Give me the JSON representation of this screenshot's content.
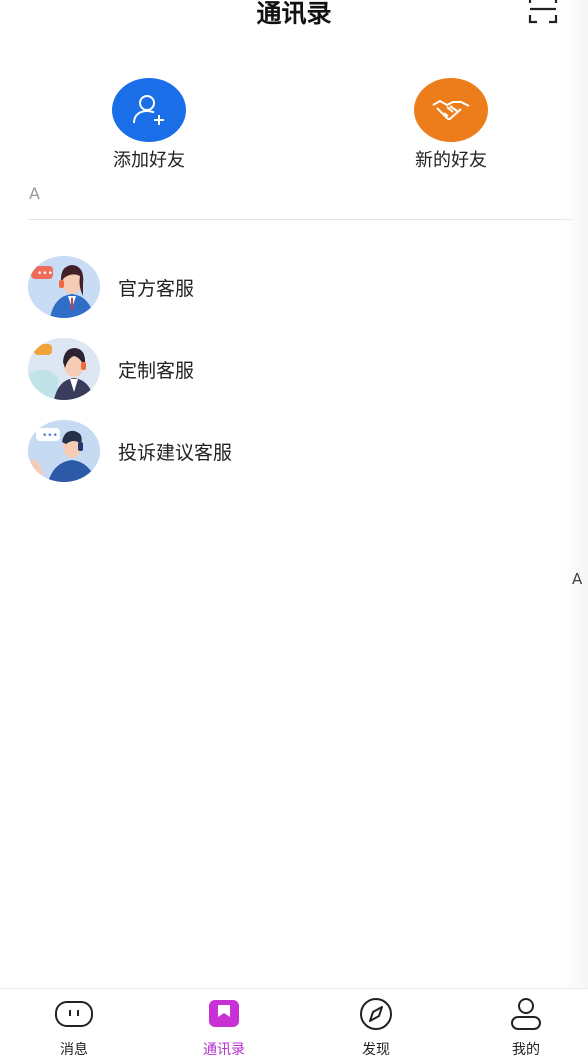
{
  "header": {
    "title": "通讯录",
    "scan_icon": "scan-icon"
  },
  "quick_actions": [
    {
      "label": "添加好友",
      "icon": "add-user-icon",
      "color": "#1a6ee8"
    },
    {
      "label": "新的好友",
      "icon": "handshake-icon",
      "color": "#ec7d1a"
    }
  ],
  "section": {
    "letter": "A"
  },
  "contacts": [
    {
      "name": "官方客服",
      "icon": "customer-service-avatar"
    },
    {
      "name": "定制客服",
      "icon": "customer-service-avatar"
    },
    {
      "name": "投诉建议客服",
      "icon": "customer-service-avatar"
    }
  ],
  "index_bar": {
    "letter": "A"
  },
  "tabbar": {
    "active_color": "#b530d0",
    "tabs": [
      {
        "label": "消息",
        "icon": "message-icon",
        "active": false
      },
      {
        "label": "通讯录",
        "icon": "contacts-icon",
        "active": true
      },
      {
        "label": "发现",
        "icon": "compass-icon",
        "active": false
      },
      {
        "label": "我的",
        "icon": "user-icon",
        "active": false
      }
    ]
  }
}
